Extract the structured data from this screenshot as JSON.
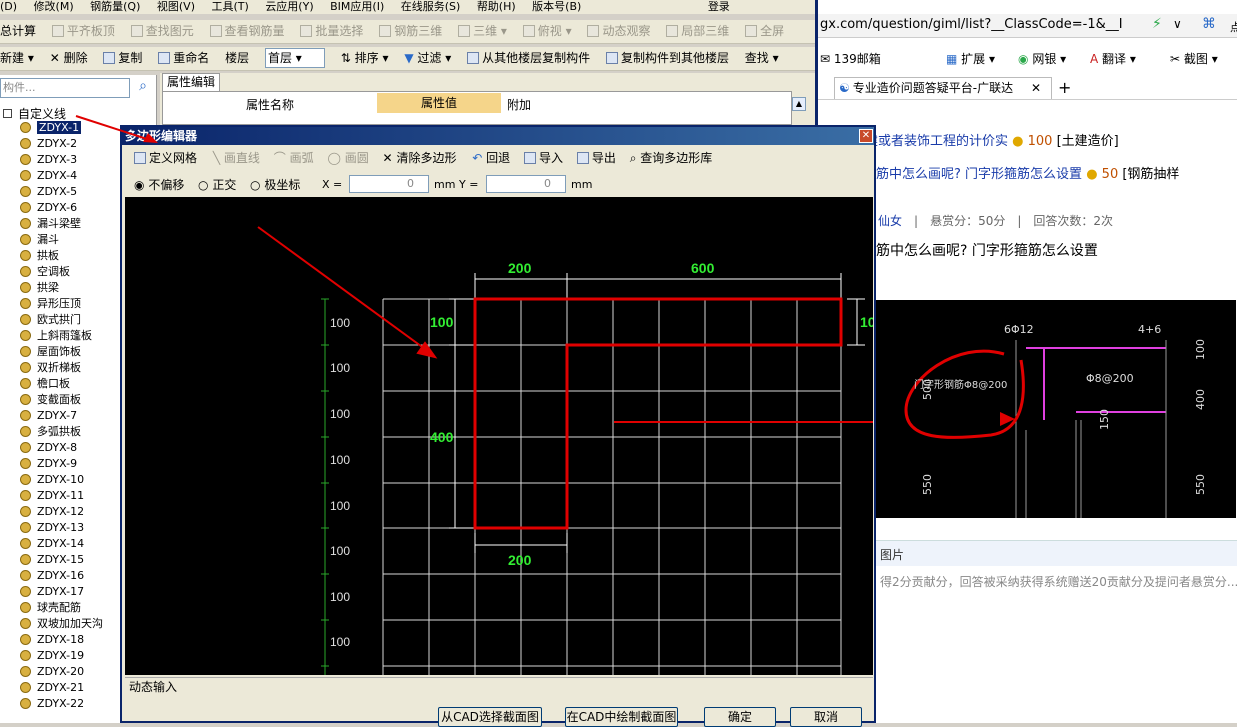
{
  "menubar": {
    "items": [
      "(D)",
      "修改(M)",
      "钢筋量(Q)",
      "视图(V)",
      "工具(T)",
      "云应用(Y)",
      "BIM应用(I)",
      "在线服务(S)",
      "帮助(H)",
      "版本号(B)"
    ],
    "login": "登录"
  },
  "toolbar1": {
    "items": [
      "总计算",
      "平齐板顶",
      "查找图元",
      "查看钢筋量",
      "批量选择",
      "钢筋三维",
      "三维",
      "俯视",
      "动态观察",
      "局部三维",
      "全屏"
    ]
  },
  "toolbar2": {
    "items": [
      "新建",
      "删除",
      "复制",
      "重命名",
      "楼层",
      "首层",
      "排序",
      "过滤",
      "从其他楼层复制构件",
      "复制构件到其他楼层",
      "查找"
    ]
  },
  "sidebar": {
    "search_placeholder": "构件...",
    "root": "自定义线",
    "items": [
      "ZDYX-1",
      "ZDYX-2",
      "ZDYX-3",
      "ZDYX-4",
      "ZDYX-5",
      "ZDYX-6",
      "漏斗梁壁",
      "漏斗",
      "拱板",
      "空调板",
      "拱梁",
      "异形压顶",
      "欧式拱门",
      "上斜雨篷板",
      "屋面饰板",
      "双折梯板",
      "檐口板",
      "变截面板",
      "ZDYX-7",
      "多弧拱板",
      "ZDYX-8",
      "ZDYX-9",
      "ZDYX-10",
      "ZDYX-11",
      "ZDYX-12",
      "ZDYX-13",
      "ZDYX-14",
      "ZDYX-15",
      "ZDYX-16",
      "ZDYX-17",
      "球壳配筋",
      "双坡加加天沟",
      "ZDYX-18",
      "ZDYX-19",
      "ZDYX-20",
      "ZDYX-21",
      "ZDYX-22"
    ]
  },
  "props": {
    "tab": "属性编辑",
    "col_name": "属性名称",
    "col_value": "属性值",
    "col_extra": "附加"
  },
  "dialog": {
    "title": "多边形编辑器",
    "toolbar": [
      "定义网格",
      "画直线",
      "画弧",
      "画圆",
      "清除多边形",
      "回退",
      "导入",
      "导出",
      "查询多边形库"
    ],
    "opt_free": "不偏移",
    "opt_ortho": "正交",
    "opt_polar": "极坐标",
    "x_label": "X =",
    "x_value": "0",
    "y_label": "Y =",
    "y_value": "0",
    "unit": "mm",
    "status": "动态输入",
    "btn_cad_select": "从CAD选择截面图",
    "btn_cad_draw": "在CAD中绘制截面图",
    "btn_ok": "确定",
    "btn_cancel": "取消",
    "row_labels": [
      "100",
      "100",
      "100",
      "100",
      "100",
      "100",
      "100",
      "100"
    ],
    "dims": {
      "top_left": "200",
      "top_right": "600",
      "left_top": "100",
      "left_mid": "400",
      "bottom": "200",
      "right": "10"
    }
  },
  "browser": {
    "url": "gx.com/question/giml/list?__ClassCode=-1&__I",
    "bookmarks": [
      "139邮箱",
      "扩展",
      "网银",
      "翻译",
      "截图"
    ],
    "tab_title": "专业造价问题答疑平台-广联达",
    "q1": "几份土建或者装饰工程的计价实",
    "q1_pts": "100",
    "q1_tag": "[土建造价]",
    "q2": "筋中怎么画呢? 门字形箍筋怎么设置",
    "q2_pts": "50",
    "q2_tag": "[钢筋抽样",
    "user": "仙女",
    "reward": "悬赏分：50分",
    "answers": "回答次数：2次",
    "q_title": "筋中怎么画呢? 门字形箍筋怎么设置",
    "pic_label": "图片",
    "footer": "得2分贡献分，回答被采纳获得系统赠送20贡献分及提问者悬赏分...",
    "cad_labels": [
      "6Φ12",
      "4+6",
      "100",
      "Φ8@200",
      "400",
      "门字形钢筋Φ8@200",
      "500",
      "550",
      "150",
      "550"
    ]
  }
}
